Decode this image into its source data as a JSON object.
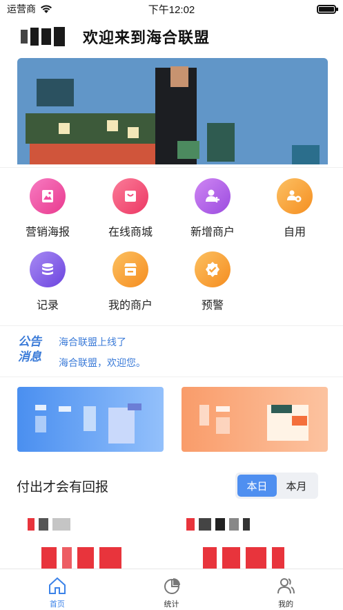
{
  "status_bar": {
    "carrier": "运营商",
    "time": "下午12:02"
  },
  "header": {
    "welcome": "欢迎来到海合联盟"
  },
  "features": [
    {
      "label": "营销海报",
      "icon": "poster-icon",
      "color": "#f14ba0"
    },
    {
      "label": "在线商城",
      "icon": "shopping-bag-icon",
      "color": "#f34c7c"
    },
    {
      "label": "新增商户",
      "icon": "add-user-icon",
      "color": "#b062e6"
    },
    {
      "label": "自用",
      "icon": "users-gear-icon",
      "color": "#f9a33b"
    },
    {
      "label": "记录",
      "icon": "database-icon",
      "color": "#8c62e8"
    },
    {
      "label": "我的商户",
      "icon": "store-icon",
      "color": "#f9a23a"
    },
    {
      "label": "预警",
      "icon": "badge-check-icon",
      "color": "#f8a33a"
    }
  ],
  "notice": {
    "badge_line1": "公告",
    "badge_line2": "消息",
    "lines": [
      "海合联盟上线了",
      "海合联盟，欢迎您。"
    ]
  },
  "section": {
    "title": "付出才会有回报",
    "tabs": [
      {
        "label": "本日",
        "active": true
      },
      {
        "label": "本月",
        "active": false
      }
    ]
  },
  "tabbar": [
    {
      "label": "首页",
      "icon": "home-icon",
      "active": true
    },
    {
      "label": "统计",
      "icon": "pie-chart-icon",
      "active": false
    },
    {
      "label": "我的",
      "icon": "profile-icon",
      "active": false
    }
  ],
  "colors": {
    "accent": "#3b82e8",
    "banner": "#6196c8",
    "stat_value": "#e8343c"
  }
}
